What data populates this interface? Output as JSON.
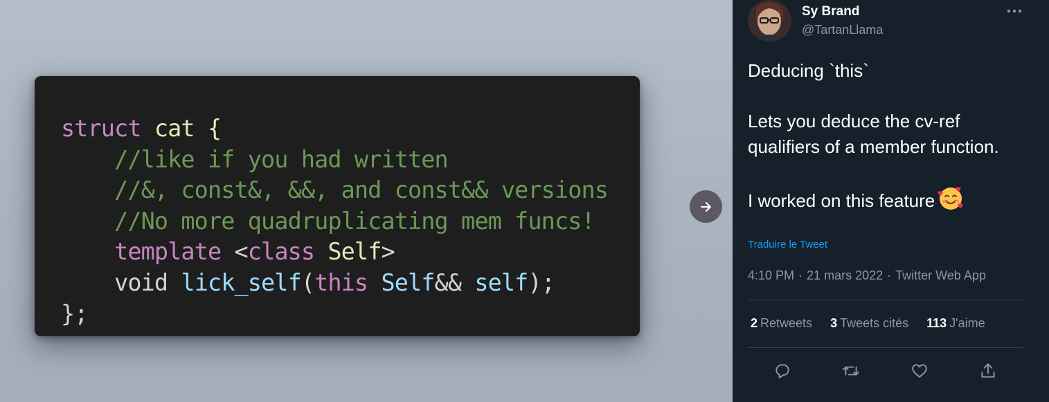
{
  "media": {
    "code_lines": [
      [
        {
          "t": "struct",
          "c": "kw-pink"
        },
        {
          "t": " cat {",
          "c": "self-t"
        }
      ],
      [
        {
          "t": "    //like if you had written",
          "c": "cmt"
        }
      ],
      [
        {
          "t": "    //&, const&, &&, and const&& versions",
          "c": "cmt"
        }
      ],
      [
        {
          "t": "    //No more quadruplicating mem funcs!",
          "c": "cmt"
        }
      ],
      [
        {
          "t": "    template",
          "c": "kw-pink"
        },
        {
          "t": " <",
          "c": "plain"
        },
        {
          "t": "class",
          "c": "kw-pink"
        },
        {
          "t": " Self",
          "c": "self-t"
        },
        {
          "t": ">",
          "c": "plain"
        }
      ],
      [
        {
          "t": "    void ",
          "c": "plain"
        },
        {
          "t": "lick_self",
          "c": "var"
        },
        {
          "t": "(",
          "c": "plain"
        },
        {
          "t": "this",
          "c": "kw-pink"
        },
        {
          "t": " Self",
          "c": "var"
        },
        {
          "t": "&& ",
          "c": "plain"
        },
        {
          "t": "self",
          "c": "var"
        },
        {
          "t": ");",
          "c": "plain"
        }
      ],
      [
        {
          "t": "};",
          "c": "plain"
        }
      ]
    ],
    "next_icon": "arrow-right-icon"
  },
  "tweet": {
    "author_name": "Sy Brand",
    "author_handle": "@TartanLlama",
    "more_icon": "more-horizontal-icon",
    "text": "Deducing `this`\n\nLets you deduce the cv-ref qualifiers of a member function.\n\nI worked on this feature",
    "emoji": "smiling-face-with-hearts-emoji",
    "translate_label": "Traduire le Tweet",
    "time": "4:10 PM",
    "date": "21 mars 2022",
    "source": "Twitter Web App",
    "separator_dot": "·",
    "stats": {
      "retweets_count": "2",
      "retweets_label": "Retweets",
      "quotes_count": "3",
      "quotes_label": "Tweets cités",
      "likes_count": "113",
      "likes_label": "J'aime"
    },
    "actions": [
      "reply-icon",
      "retweet-icon",
      "like-icon",
      "share-icon"
    ]
  },
  "colors": {
    "panel_bg": "#15202b",
    "link": "#1d9bf0",
    "secondary_text": "#8b98a5"
  }
}
